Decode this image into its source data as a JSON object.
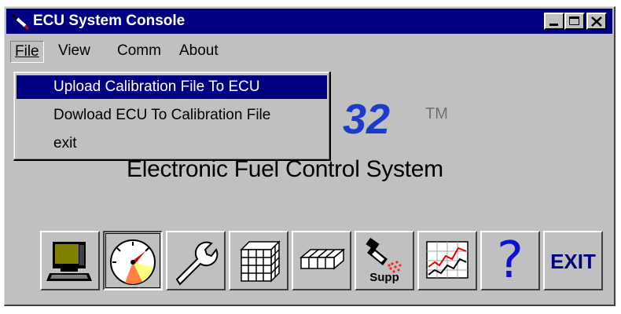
{
  "window": {
    "title": "ECU System Console"
  },
  "menubar": {
    "items": [
      {
        "label": "File"
      },
      {
        "label": "View"
      },
      {
        "label": "Comm"
      },
      {
        "label": "About"
      }
    ]
  },
  "file_menu": {
    "items": [
      {
        "label": "Upload Calibration File To ECU"
      },
      {
        "label": "Dowload ECU To Calibration File"
      },
      {
        "label": "exit"
      }
    ]
  },
  "branding": {
    "logo_visible": "32",
    "trademark": "TM",
    "subtitle": "Electronic Fuel Control System"
  },
  "toolbar": {
    "buttons": [
      {
        "icon": "computer-icon"
      },
      {
        "icon": "gauge-icon"
      },
      {
        "icon": "wrench-icon"
      },
      {
        "icon": "grid-3d-icon"
      },
      {
        "icon": "grid-flat-icon"
      },
      {
        "icon": "injector-spray-icon",
        "label": "Supp"
      },
      {
        "icon": "line-chart-icon"
      },
      {
        "icon": "help-icon",
        "label": "?"
      },
      {
        "icon": "exit-icon",
        "label": "EXIT"
      }
    ]
  },
  "colors": {
    "titlebar": "#000080",
    "window_bg": "#c0c0c0",
    "logo": "#1a3cc8",
    "menu_highlight": "#000080"
  }
}
